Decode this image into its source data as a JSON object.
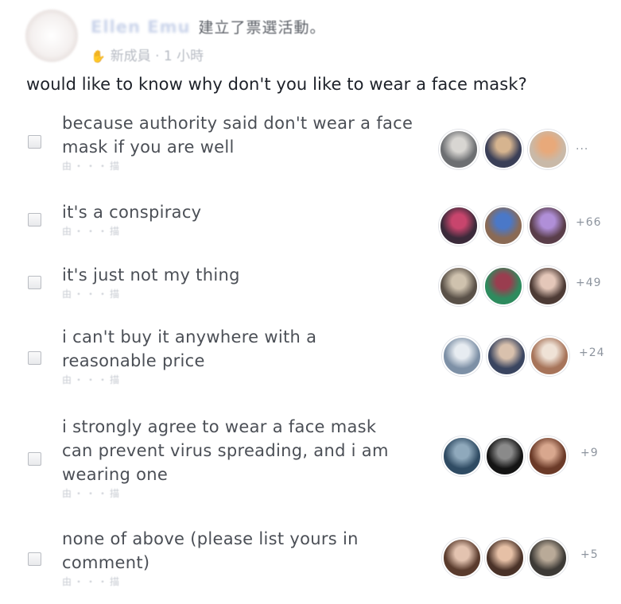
{
  "post": {
    "author_name": "Ellen Emu",
    "action_text": "建立了票選活動。",
    "meta_text": "新成員 · 1 小時",
    "question": "would like to know why don't you like to wear a face mask?"
  },
  "options": [
    {
      "line1": "because authority said don't wear a face",
      "line2": "mask if you are well",
      "line3": "",
      "sub": "由・・・描",
      "more": "...",
      "avatar_colors": [
        [
          "#6d6f72",
          "#d8d6d2"
        ],
        [
          "#3a3f57",
          "#d6b48f"
        ],
        [
          "#c9b9a8",
          "#e8a97a"
        ]
      ]
    },
    {
      "line1": "it's a conspiracy",
      "line2": "",
      "line3": "",
      "sub": "由・・・描",
      "more": "+66",
      "avatar_colors": [
        [
          "#3b2a3a",
          "#c8456d"
        ],
        [
          "#8a6a55",
          "#4a78c8"
        ],
        [
          "#5a3e4a",
          "#b08fd8"
        ]
      ]
    },
    {
      "line1": "it's just not my thing",
      "line2": "",
      "line3": "",
      "sub": "由・・・描",
      "more": "+49",
      "avatar_colors": [
        [
          "#5a5148",
          "#cfc2ae"
        ],
        [
          "#2e8b5e",
          "#9a3d4f"
        ],
        [
          "#4d3b35",
          "#e4c7b9"
        ]
      ]
    },
    {
      "line1": "i can't buy it anywhere with a",
      "line2": "reasonable price",
      "line3": "",
      "sub": "由・・・描",
      "more": "+24",
      "avatar_colors": [
        [
          "#7d90a6",
          "#e7ecf1"
        ],
        [
          "#3a4560",
          "#d9c1ad"
        ],
        [
          "#a7745a",
          "#efe2d6"
        ]
      ]
    },
    {
      "line1": "i strongly agree to wear a face mask",
      "line2": "can prevent virus spreading, and i am",
      "line3": "wearing one",
      "sub": "由・・・描",
      "more": "+9",
      "avatar_colors": [
        [
          "#2f4b63",
          "#8fa9bc"
        ],
        [
          "#141414",
          "#8a8a8a"
        ],
        [
          "#6b3a28",
          "#d8a78e"
        ]
      ]
    },
    {
      "line1": "none of above (please list yours in",
      "line2": "comment)",
      "line3": "",
      "sub": "由・・・描",
      "more": "+5",
      "avatar_colors": [
        [
          "#5a3b2d",
          "#e3c3b0"
        ],
        [
          "#4a3228",
          "#e6c0a6"
        ],
        [
          "#3d3a36",
          "#b9aa98"
        ]
      ]
    }
  ]
}
